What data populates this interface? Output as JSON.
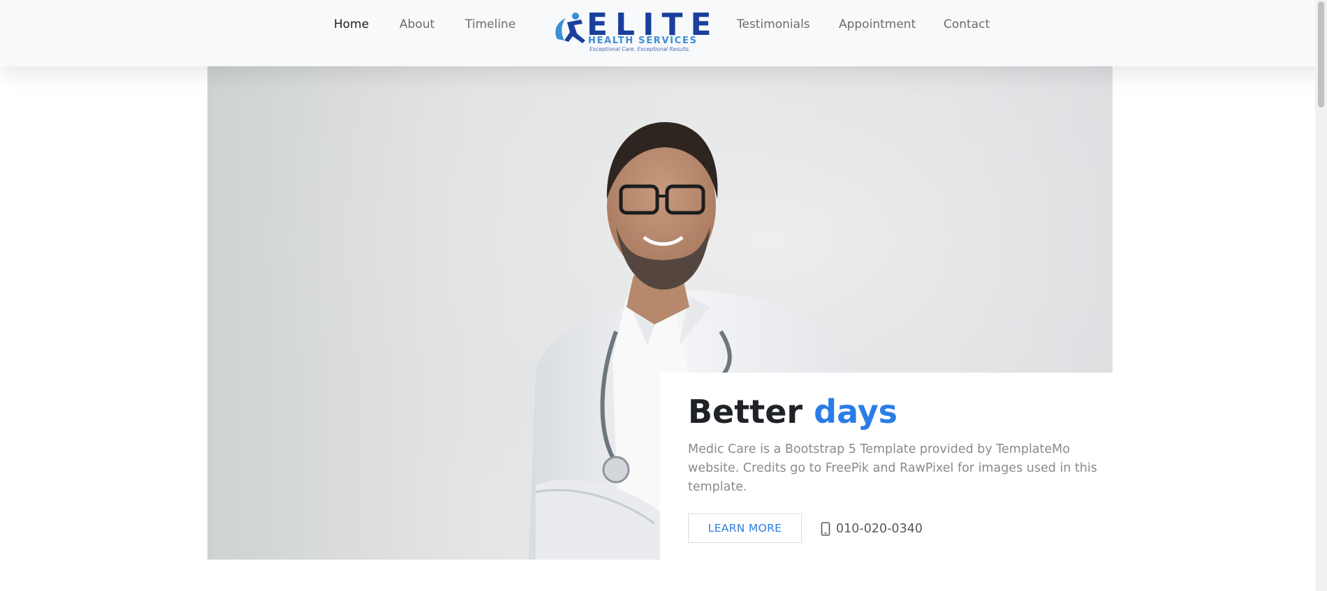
{
  "nav": {
    "items": [
      {
        "label": "Home",
        "active": true
      },
      {
        "label": "About",
        "active": false
      },
      {
        "label": "Timeline",
        "active": false
      },
      {
        "label": "Testimonials",
        "active": false
      },
      {
        "label": "Appointment",
        "active": false
      },
      {
        "label": "Contact",
        "active": false
      }
    ],
    "logo": {
      "name": "ELITE",
      "subtitle": "HEALTH SERVICES",
      "tagline": "Exceptional Care. Exceptional Results."
    }
  },
  "hero": {
    "title_main": "Better ",
    "title_accent": "days",
    "description": "Medic Care is a Bootstrap 5 Template provided by TemplateMo website. Credits go to FreePik and RawPixel for images used in this template.",
    "cta_label": "LEARN MORE",
    "phone": "010-020-0340"
  },
  "colors": {
    "accent": "#2b7de6",
    "logo_primary": "#1a3f9c",
    "logo_secondary": "#3a8fd6",
    "nav_background": "#f8f9fb"
  },
  "icons": {
    "phone": "mobile-phone-icon",
    "logo": "running-figure-icon"
  }
}
